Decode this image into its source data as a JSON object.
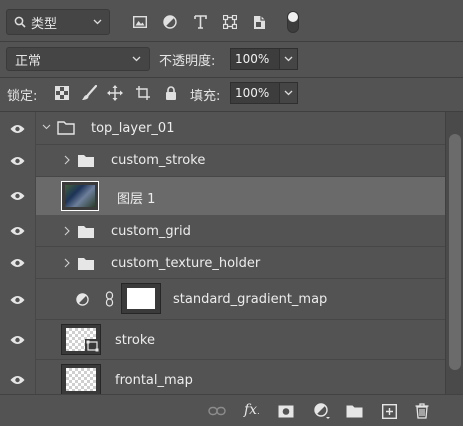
{
  "filter": {
    "kind_label": "类型"
  },
  "blend": {
    "mode": "正常",
    "opacity_label": "不透明度:",
    "opacity_value": "100%"
  },
  "lock": {
    "label": "锁定:",
    "fill_label": "填充:",
    "fill_value": "100%"
  },
  "layers": [
    {
      "name": "top_layer_01",
      "kind": "group",
      "expanded": true
    },
    {
      "name": "custom_stroke",
      "kind": "group",
      "expanded": false
    },
    {
      "name": "图层 1",
      "kind": "pixel",
      "selected": true
    },
    {
      "name": "custom_grid",
      "kind": "group",
      "expanded": false
    },
    {
      "name": "custom_texture_holder",
      "kind": "group",
      "expanded": false
    },
    {
      "name": "standard_gradient_map",
      "kind": "adjustment"
    },
    {
      "name": "stroke",
      "kind": "pixel"
    },
    {
      "name": "frontal_map",
      "kind": "pixel"
    }
  ],
  "bottom_icons": [
    "link-icon",
    "fx-icon",
    "mask-icon",
    "adjustment-icon",
    "folder-icon",
    "new-layer-icon",
    "trash-icon"
  ],
  "colors": {
    "panel": "#535353",
    "selected_row": "#6a6a6a",
    "input": "#3d3d3d"
  }
}
